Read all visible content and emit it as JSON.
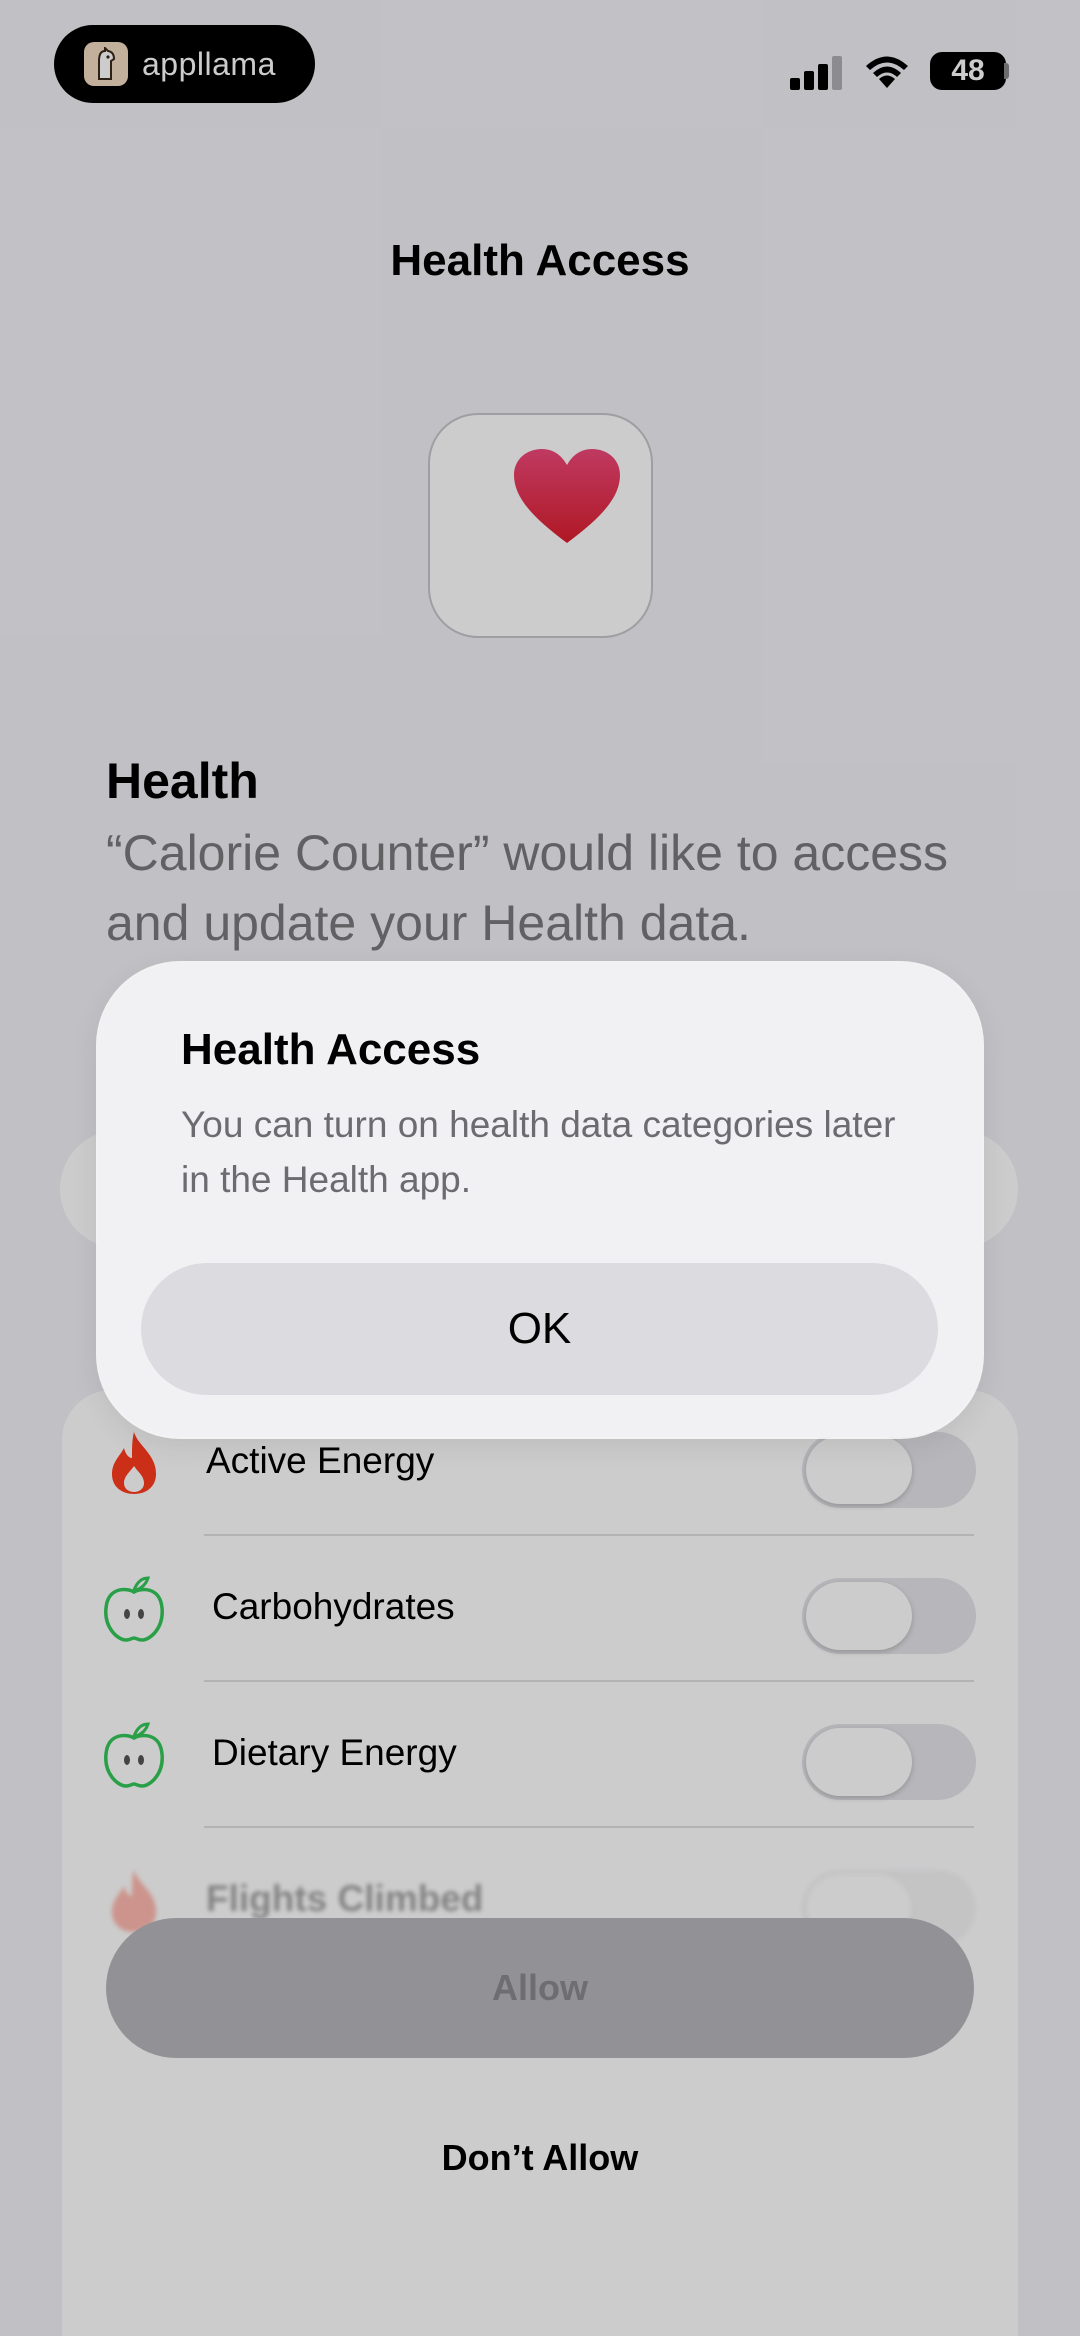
{
  "status_bar": {
    "brand": "appllama",
    "battery": "48"
  },
  "screen": {
    "title": "Health Access",
    "section_heading": "Health",
    "description": "“Calorie Counter” would like to access and update your Health data."
  },
  "categories": [
    {
      "label": "Active Energy",
      "icon": "flame-icon",
      "icon_color": "#ff3b1f",
      "enabled": false
    },
    {
      "label": "Carbohydrates",
      "icon": "apple-icon",
      "icon_color": "#34c759",
      "enabled": false
    },
    {
      "label": "Dietary Energy",
      "icon": "apple-icon",
      "icon_color": "#34c759",
      "enabled": false
    },
    {
      "label": "Flights Climbed",
      "icon": "flame-icon",
      "icon_color": "#ff3b1f",
      "enabled": false
    }
  ],
  "buttons": {
    "allow": "Allow",
    "dont_allow": "Don’t Allow"
  },
  "alert": {
    "title": "Health Access",
    "message": "You can turn on health data categories later in the Health app.",
    "ok": "OK"
  },
  "colors": {
    "heart": "#e8264a",
    "flame": "#ff3b1f",
    "apple": "#34c759"
  }
}
